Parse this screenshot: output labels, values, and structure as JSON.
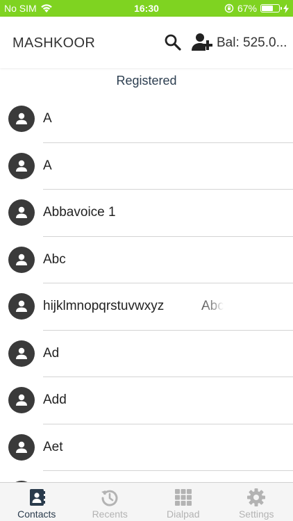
{
  "status_bar": {
    "carrier": "No SIM",
    "time": "16:30",
    "battery_percent": "67%",
    "battery_level": 0.67
  },
  "header": {
    "title": "MASHKOOR",
    "balance": "Bal: 525.0..."
  },
  "section_label": "Registered",
  "contacts": [
    {
      "name": "A"
    },
    {
      "name": "A"
    },
    {
      "name": "Abbavoice 1"
    },
    {
      "name": "Abc"
    },
    {
      "name": "hijklmnopqrstuvwxyz",
      "trailing": "Abc"
    },
    {
      "name": "Ad"
    },
    {
      "name": "Add"
    },
    {
      "name": "Aet"
    },
    {
      "name": ""
    }
  ],
  "tabs": [
    {
      "label": "Contacts",
      "active": true,
      "icon": "contacts-icon"
    },
    {
      "label": "Recents",
      "active": false,
      "icon": "recents-icon"
    },
    {
      "label": "Dialpad",
      "active": false,
      "icon": "dialpad-icon"
    },
    {
      "label": "Settings",
      "active": false,
      "icon": "settings-icon"
    }
  ],
  "colors": {
    "status_bar": "#7fd321",
    "tab_active": "#2a3b4c",
    "tab_inactive": "#b3b3b3",
    "avatar": "#3a3a3a"
  }
}
